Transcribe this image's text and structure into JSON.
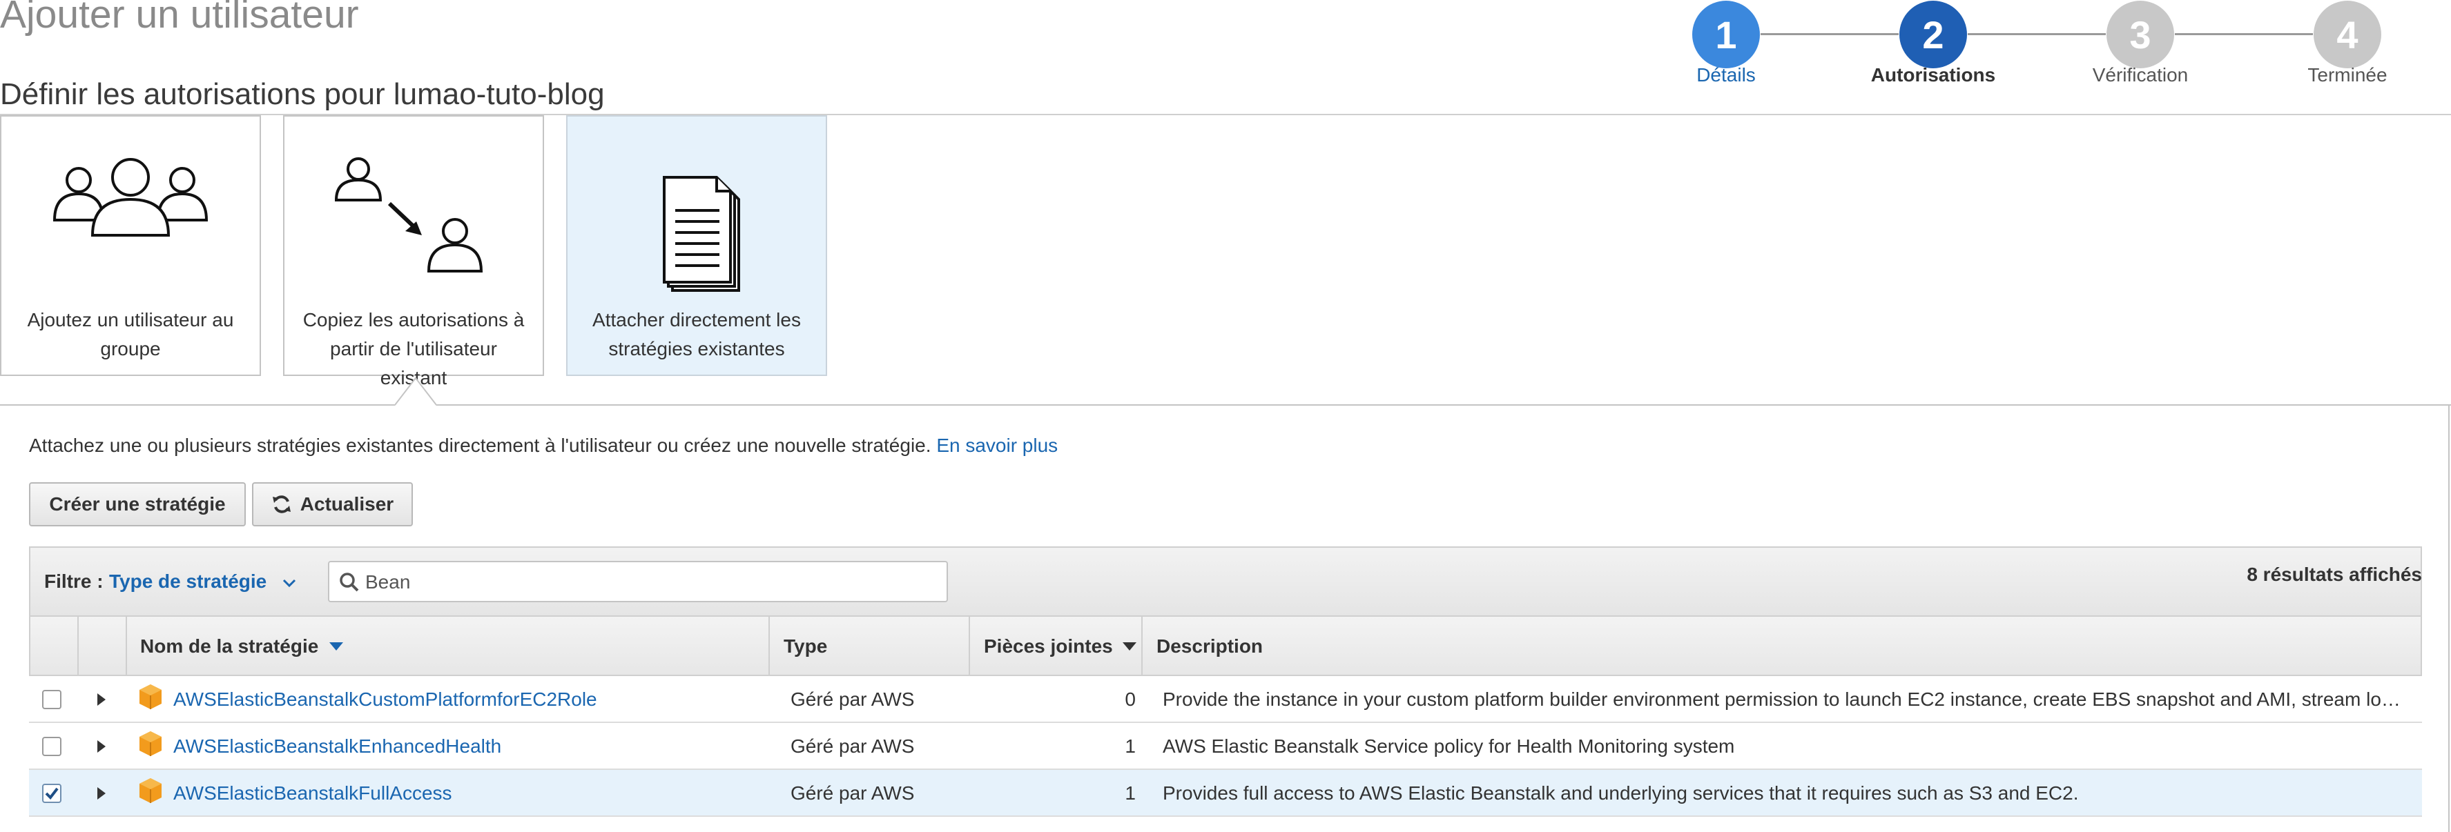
{
  "page": {
    "title": "Ajouter un utilisateur",
    "section_title": "Définir les autorisations pour lumao-tuto-blog"
  },
  "wizard": {
    "steps": [
      {
        "number": "1",
        "label": "Détails",
        "state": "completed"
      },
      {
        "number": "2",
        "label": "Autorisations",
        "state": "current"
      },
      {
        "number": "3",
        "label": "Vérification",
        "state": "upcoming"
      },
      {
        "number": "4",
        "label": "Terminée",
        "state": "upcoming"
      }
    ]
  },
  "options": [
    {
      "label": "Ajoutez un utilisateur au groupe",
      "icon": "user-group-icon",
      "selected": false
    },
    {
      "label": "Copiez les autorisations à partir de l'utilisateur existant",
      "icon": "copy-user-permissions-icon",
      "selected": false
    },
    {
      "label": "Attacher directement les stratégies existantes",
      "icon": "policy-documents-icon",
      "selected": true
    }
  ],
  "panel": {
    "description": "Attachez une ou plusieurs stratégies existantes directement à l'utilisateur ou créez une nouvelle stratégie.",
    "learn_more": "En savoir plus",
    "create_button": "Créer une stratégie",
    "refresh_button": "Actualiser"
  },
  "filter": {
    "label": "Filtre :",
    "type_value": "Type de stratégie",
    "search_value": "Bean",
    "results": "8 résultats affichés"
  },
  "table": {
    "columns": {
      "name": "Nom de la stratégie",
      "type": "Type",
      "attachments": "Pièces jointes",
      "description": "Description"
    },
    "rows": [
      {
        "name": "AWSElasticBeanstalkCustomPlatformforEC2Role",
        "type": "Géré par AWS",
        "attachments": "0",
        "description": "Provide the instance in your custom platform builder environment permission to launch EC2 instance, create EBS snapshot and AMI, stream lo…",
        "checked": false
      },
      {
        "name": "AWSElasticBeanstalkEnhancedHealth",
        "type": "Géré par AWS",
        "attachments": "1",
        "description": "AWS Elastic Beanstalk Service policy for Health Monitoring system",
        "checked": false
      },
      {
        "name": "AWSElasticBeanstalkFullAccess",
        "type": "Géré par AWS",
        "attachments": "1",
        "description": "Provides full access to AWS Elastic Beanstalk and underlying services that it requires such as S3 and EC2.",
        "checked": true
      }
    ]
  },
  "colors": {
    "step_completed": "#3b88dd",
    "step_current": "#1f5fb4",
    "step_upcoming": "#c8c8c8",
    "link": "#1a66b0",
    "selected_bg": "#e6f2fb",
    "aws_orange": "#f29b1d"
  }
}
